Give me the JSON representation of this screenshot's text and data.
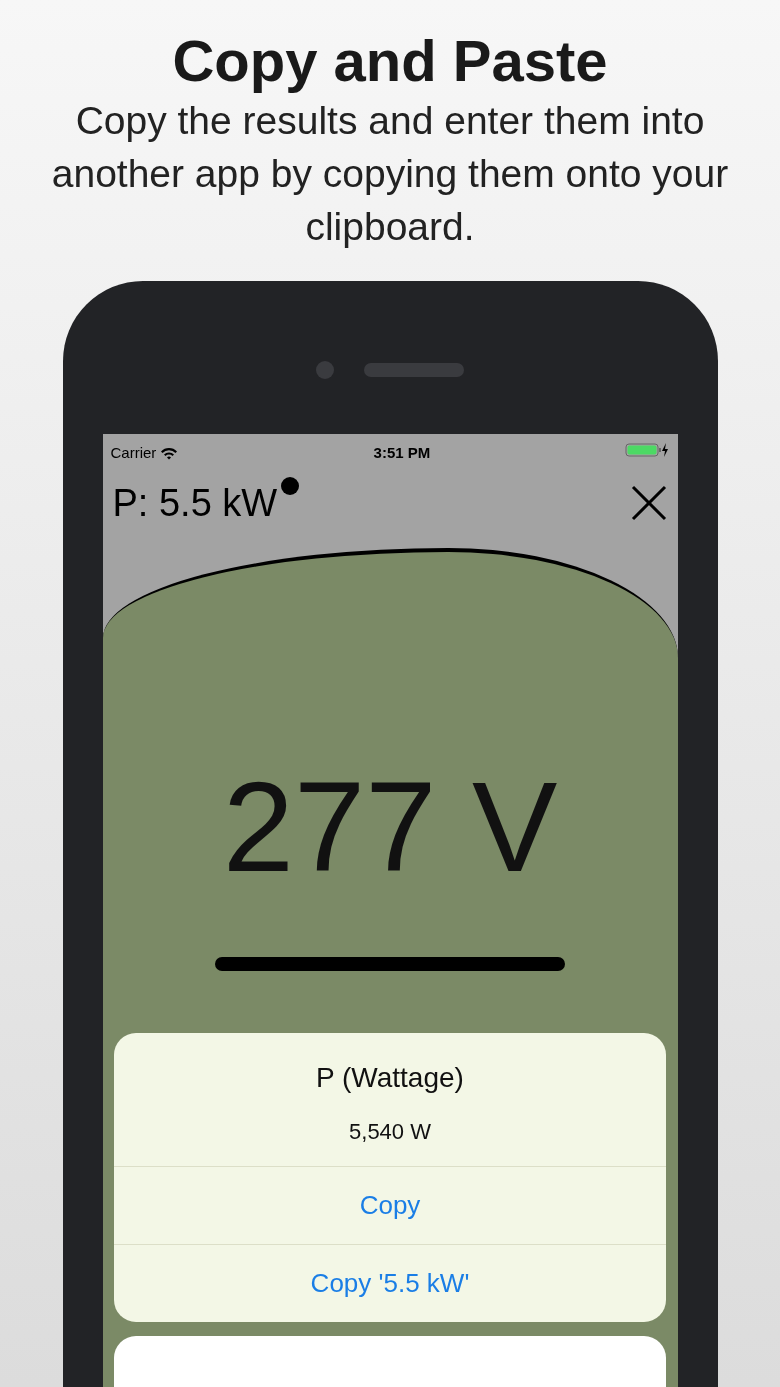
{
  "header": {
    "title": "Copy and Paste",
    "subtitle": "Copy the results and enter them into another app by copying them onto your clipboard."
  },
  "status_bar": {
    "carrier": "Carrier",
    "time": "3:51 PM"
  },
  "screen": {
    "title": "P: 5.5 kW",
    "reading": "277 V"
  },
  "action_sheet": {
    "title": "P (Wattage)",
    "message": "5,540 W",
    "actions": [
      "Copy",
      "Copy '5.5 kW'"
    ]
  }
}
